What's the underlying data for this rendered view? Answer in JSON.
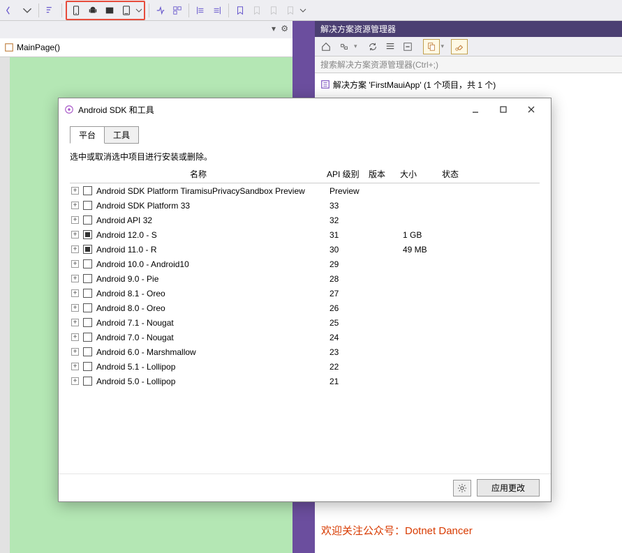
{
  "toolbar": {},
  "mainpage": {
    "label": "MainPage()"
  },
  "solution": {
    "panel_title": "解决方案资源管理器",
    "search_placeholder": "搜索解决方案资源管理器(Ctrl+;)",
    "root": "解决方案 'FirstMauiApp' (1 个项目，共 1 个)"
  },
  "dialog": {
    "title": "Android SDK 和工具",
    "tabs": {
      "platforms": "平台",
      "tools": "工具"
    },
    "instruction": "选中或取消选中项目进行安装或删除。",
    "columns": {
      "name": "名称",
      "api": "API 级别",
      "version": "版本",
      "size": "大小",
      "state": "状态"
    },
    "apply": "应用更改",
    "rows": [
      {
        "name": "Android SDK Platform TiramisuPrivacySandbox Preview",
        "api": "Preview",
        "size": "",
        "checked": "none"
      },
      {
        "name": "Android SDK Platform 33",
        "api": "33",
        "size": "",
        "checked": "none"
      },
      {
        "name": "Android API 32",
        "api": "32",
        "size": "",
        "checked": "none"
      },
      {
        "name": "Android 12.0 - S",
        "api": "31",
        "size": "1 GB",
        "checked": "indeterminate"
      },
      {
        "name": "Android 11.0 - R",
        "api": "30",
        "size": "49 MB",
        "checked": "indeterminate"
      },
      {
        "name": "Android 10.0 - Android10",
        "api": "29",
        "size": "",
        "checked": "none"
      },
      {
        "name": "Android 9.0 - Pie",
        "api": "28",
        "size": "",
        "checked": "none"
      },
      {
        "name": "Android 8.1 - Oreo",
        "api": "27",
        "size": "",
        "checked": "none"
      },
      {
        "name": "Android 8.0 - Oreo",
        "api": "26",
        "size": "",
        "checked": "none"
      },
      {
        "name": "Android 7.1 - Nougat",
        "api": "25",
        "size": "",
        "checked": "none"
      },
      {
        "name": "Android 7.0 - Nougat",
        "api": "24",
        "size": "",
        "checked": "none"
      },
      {
        "name": "Android 6.0 - Marshmallow",
        "api": "23",
        "size": "",
        "checked": "none"
      },
      {
        "name": "Android 5.1 - Lollipop",
        "api": "22",
        "size": "",
        "checked": "none"
      },
      {
        "name": "Android 5.0 - Lollipop",
        "api": "21",
        "size": "",
        "checked": "none"
      }
    ]
  },
  "footer": "欢迎关注公众号：Dotnet Dancer"
}
